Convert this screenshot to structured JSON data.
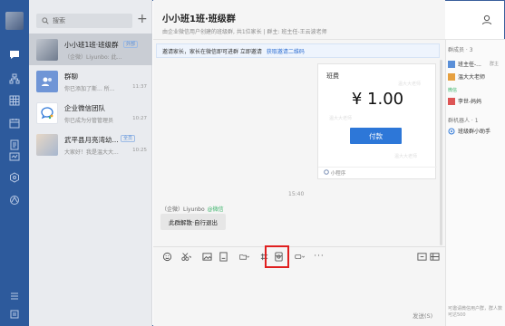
{
  "search": {
    "placeholder": "搜索"
  },
  "sessions": [
    {
      "name": "小小班1班·班级群",
      "badge": "外部",
      "preview": "（企微）Liyunbo: 此...",
      "time": ""
    },
    {
      "name": "群聊",
      "preview": "你已添加了斯... 所...",
      "time": "11:37"
    },
    {
      "name": "企业微信团队",
      "preview": "你已成为分管管理员",
      "time": "10:27"
    },
    {
      "name": "武平县月亮湾幼...",
      "badge": "全员",
      "preview": "大家好！我是温大大...",
      "time": "10:25"
    }
  ],
  "chat": {
    "title": "小小班1班·班级群",
    "subtitle": "由企业微信用户创建的班级群, 共1位家长 | 群主: 班主任-王云波老师",
    "notice_text": "邀请家长，家长在微信即可进群 立即邀请",
    "notice_link": "获取邀请二维码",
    "card_title": "班费",
    "card_amount": "¥ 1.00",
    "card_button": "付款",
    "card_watermark": "温大大老师",
    "card_footer": "小程序",
    "time": "15:40",
    "sender": "（企微）Liyunbo",
    "sender_tag": "@微信",
    "message": "此群解散·自行退出",
    "send_label": "发送(S)"
  },
  "members": {
    "header1": "群成员 · 3",
    "m1": "班主任-...",
    "m1_tag": "群主",
    "m2": "温大大老师",
    "wechat_label": "微信",
    "m3": "李世-妈妈",
    "header2": "群机器人 · 1",
    "bot": "班级群小助手",
    "footer": "可邀请微信用户群，群人数可达500"
  },
  "colors": {
    "nav": "#2d5a9c",
    "accent": "#2d77d8",
    "highlight": "#e02020"
  }
}
